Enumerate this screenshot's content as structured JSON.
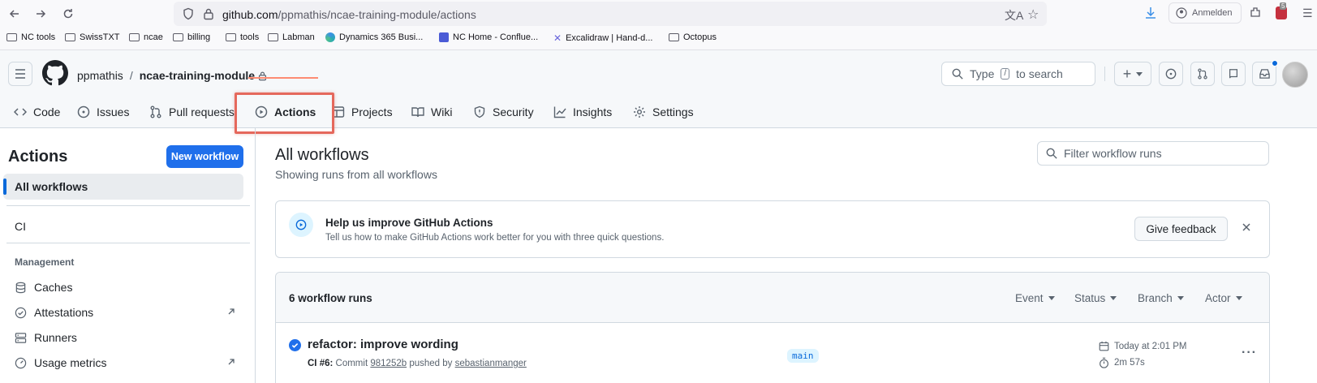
{
  "browser": {
    "url_domain": "github.com",
    "url_path": "/ppmathis/ncae-training-module/actions",
    "profile_label": "Anmelden",
    "extension_badge": "5",
    "bookmarks": [
      "NC tools",
      "SwissTXT",
      "ncae",
      "billing",
      "tools",
      "Labman",
      "Dynamics 365 Busi...",
      "NC Home - Conflue...",
      "Excalidraw | Hand-d...",
      "Octopus"
    ]
  },
  "header": {
    "owner": "ppmathis",
    "separator": "/",
    "repo": "ncae-training-module",
    "search_prefix": "Type",
    "search_key": "/",
    "search_suffix": "to search",
    "plus": "+"
  },
  "tabs": [
    {
      "label": "Code",
      "icon": "code-icon"
    },
    {
      "label": "Issues",
      "icon": "issue-icon"
    },
    {
      "label": "Pull requests",
      "icon": "pull-request-icon"
    },
    {
      "label": "Actions",
      "icon": "play-icon",
      "active": true
    },
    {
      "label": "Projects",
      "icon": "table-icon"
    },
    {
      "label": "Wiki",
      "icon": "book-icon"
    },
    {
      "label": "Security",
      "icon": "shield-icon"
    },
    {
      "label": "Insights",
      "icon": "graph-icon"
    },
    {
      "label": "Settings",
      "icon": "gear-icon"
    }
  ],
  "sidebar": {
    "title": "Actions",
    "new_workflow": "New workflow",
    "all_workflows": "All workflows",
    "workflows": [
      "CI"
    ],
    "management_heading": "Management",
    "management": [
      {
        "label": "Caches",
        "icon": "database-icon"
      },
      {
        "label": "Attestations",
        "icon": "verified-icon",
        "external": true
      },
      {
        "label": "Runners",
        "icon": "server-icon"
      },
      {
        "label": "Usage metrics",
        "icon": "meter-icon",
        "external": true
      }
    ]
  },
  "main": {
    "title": "All workflows",
    "subtitle": "Showing runs from all workflows",
    "filter_placeholder": "Filter workflow runs",
    "banner": {
      "title": "Help us improve GitHub Actions",
      "text": "Tell us how to make GitHub Actions work better for you with three quick questions.",
      "button": "Give feedback"
    },
    "runs_count": "6 workflow runs",
    "filters": [
      "Event",
      "Status",
      "Branch",
      "Actor"
    ],
    "runs": [
      {
        "title": "refactor: improve wording",
        "workflow": "CI #6:",
        "commit_prefix": "Commit",
        "commit": "981252b",
        "pushed_by": "pushed by",
        "author": "sebastianmanger",
        "branch": "main",
        "date": "Today at 2:01 PM",
        "duration": "2m 57s",
        "status": "success"
      }
    ]
  }
}
